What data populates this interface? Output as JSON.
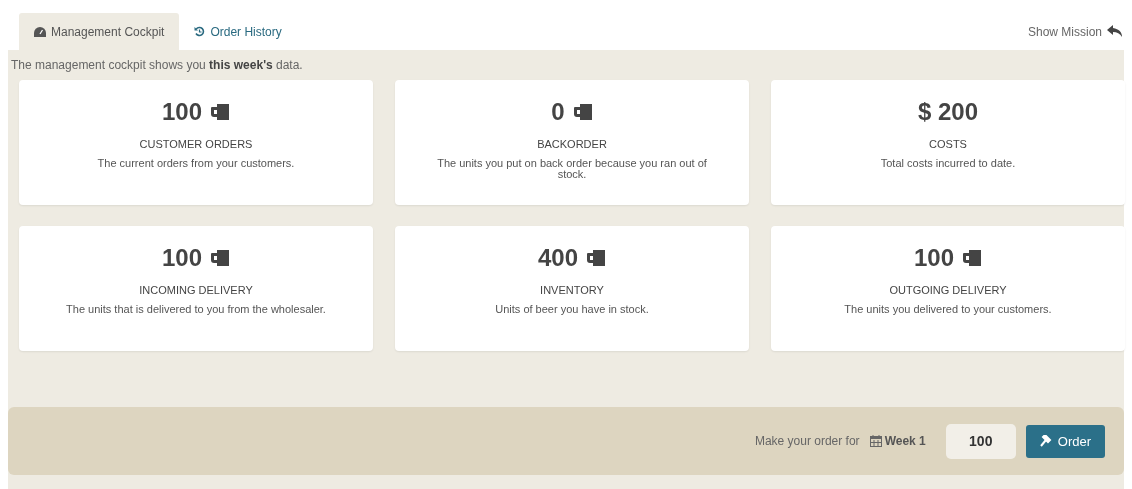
{
  "tabs": [
    {
      "label": "Management Cockpit",
      "kind": "dashboard",
      "selected": true
    },
    {
      "label": "Order History",
      "kind": "history",
      "selected": false
    }
  ],
  "show_mission": "Show Mission",
  "intro": "The management cockpit shows you **this week's** data.",
  "cards": [
    {
      "kind": "units",
      "value": "100",
      "title": "CUSTOMER ORDERS",
      "description": "The current orders from your customers."
    },
    {
      "kind": "units",
      "value": "0",
      "title": "BACKORDER",
      "description": "The units you put on back order because you ran out of stock."
    },
    {
      "kind": "money",
      "value": "$ 200",
      "title": "COSTS",
      "description": "Total costs incurred to date."
    },
    {
      "kind": "units",
      "value": "100",
      "title": "INCOMING DELIVERY",
      "description": "The units that is delivered to you from the wholesaler."
    },
    {
      "kind": "units",
      "value": "400",
      "title": "INVENTORY",
      "description": "Units of beer you have in stock."
    },
    {
      "kind": "units",
      "value": "100",
      "title": "OUTGOING DELIVERY",
      "description": "The units you delivered to your customers."
    }
  ],
  "order_bar": {
    "label": "Make your order for",
    "week": "Week 1",
    "quantity": "100",
    "button": "Order"
  }
}
